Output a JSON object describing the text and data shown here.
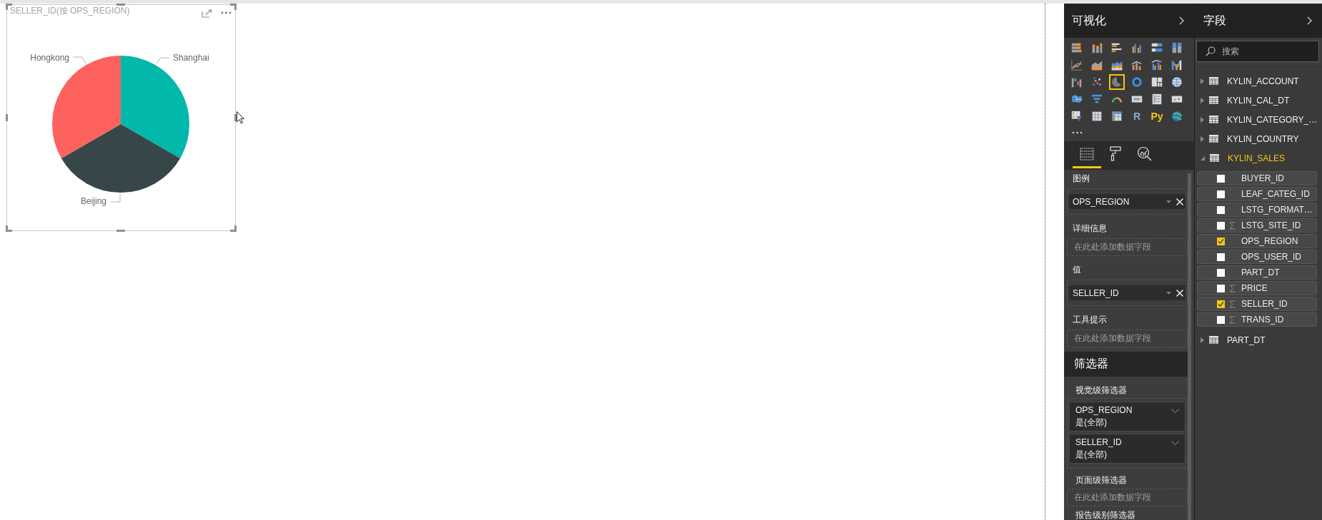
{
  "top_visual": {
    "title": "SELLER_ID(按 OPS_REGION)",
    "slices": [
      {
        "label": "Shanghai",
        "color": "#01b8aa"
      },
      {
        "label": "Beijing",
        "color": "#374649"
      },
      {
        "label": "Hongkong",
        "color": "#fd625e"
      }
    ]
  },
  "visualizations_pane": {
    "title": "可视化",
    "visual_types": [
      {
        "selected": false
      },
      {
        "selected": false
      },
      {
        "selected": false
      },
      {
        "selected": false
      },
      {
        "selected": false
      },
      {
        "selected": false
      },
      {
        "selected": false
      },
      {
        "selected": false
      },
      {
        "selected": false
      },
      {
        "selected": false
      },
      {
        "selected": false
      },
      {
        "selected": false
      },
      {
        "selected": false
      },
      {
        "selected": false
      },
      {
        "selected": true
      },
      {
        "selected": false
      },
      {
        "selected": false
      },
      {
        "selected": false
      },
      {
        "selected": false
      },
      {
        "selected": false
      },
      {
        "selected": false
      },
      {
        "selected": false
      },
      {
        "selected": false
      },
      {
        "selected": false
      },
      {
        "selected": false
      },
      {
        "selected": false
      },
      {
        "selected": false
      },
      {
        "selected": false,
        "glyph": "R"
      },
      {
        "selected": false,
        "glyph": "Py"
      },
      {
        "selected": false
      }
    ],
    "tabs": [
      {
        "selected": true
      },
      {
        "selected": false
      },
      {
        "selected": false
      }
    ],
    "wells": [
      {
        "kind": "field",
        "label": "图例",
        "field": "OPS_REGION"
      },
      {
        "kind": "empty",
        "label": "详细信息",
        "hint": "在此处添加数据字段"
      },
      {
        "kind": "field",
        "label": "值",
        "field": "SELLER_ID"
      },
      {
        "kind": "empty",
        "label": "工具提示",
        "hint": "在此处添加数据字段"
      }
    ],
    "filters": {
      "title": "筛选器",
      "sections": [
        {
          "kind": "cards",
          "label": "视觉级筛选器",
          "cards": [
            {
              "field": "OPS_REGION",
              "condition": "是(全部)"
            },
            {
              "field": "SELLER_ID",
              "condition": "是(全部)"
            }
          ]
        },
        {
          "kind": "drop",
          "label": "页面级筛选器",
          "hint": "在此处添加数据字段"
        },
        {
          "kind": "header",
          "label": "报告级别筛选器"
        }
      ]
    }
  },
  "fields_pane": {
    "title": "字段",
    "search": {
      "placeholder": "搜索"
    },
    "tables": [
      {
        "name": "KYLIN_ACCOUNT",
        "expanded": false,
        "active": false
      },
      {
        "name": "KYLIN_CAL_DT",
        "expanded": false,
        "active": false
      },
      {
        "name": "KYLIN_CATEGORY_…",
        "expanded": false,
        "active": false
      },
      {
        "name": "KYLIN_COUNTRY",
        "expanded": false,
        "active": false
      },
      {
        "name": "KYLIN_SALES",
        "expanded": true,
        "active": true,
        "children": [
          {
            "name": "BUYER_ID",
            "checked": false,
            "summable": false
          },
          {
            "name": "LEAF_CATEG_ID",
            "checked": false,
            "summable": false
          },
          {
            "name": "LSTG_FORMAT…",
            "checked": false,
            "summable": false
          },
          {
            "name": "LSTG_SITE_ID",
            "checked": false,
            "summable": true
          },
          {
            "name": "OPS_REGION",
            "checked": true,
            "summable": false
          },
          {
            "name": "OPS_USER_ID",
            "checked": false,
            "summable": false
          },
          {
            "name": "PART_DT",
            "checked": false,
            "summable": false
          },
          {
            "name": "PRICE",
            "checked": false,
            "summable": true
          },
          {
            "name": "SELLER_ID",
            "checked": true,
            "summable": true
          },
          {
            "name": "TRANS_ID",
            "checked": false,
            "summable": true
          }
        ]
      },
      {
        "name": "PART_DT",
        "expanded": false,
        "active": false
      }
    ]
  }
}
